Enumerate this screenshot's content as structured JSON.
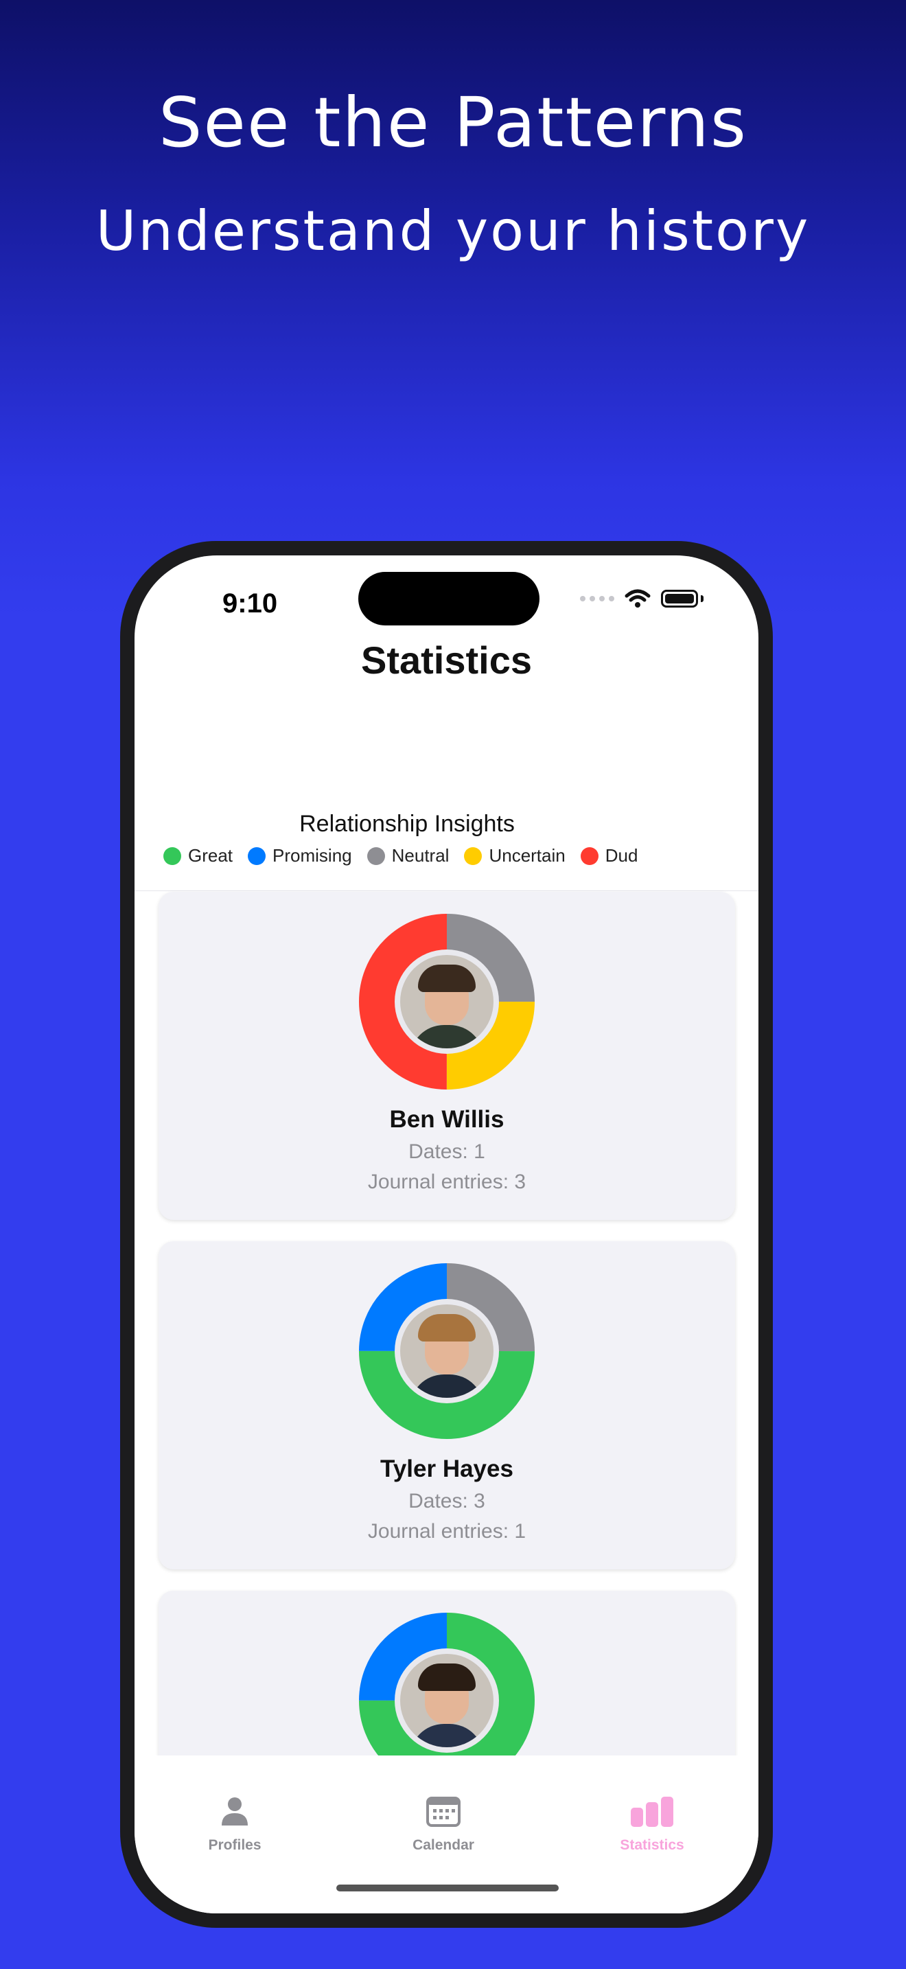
{
  "promo": {
    "headline": "See the Patterns",
    "subheadline": "Understand your history"
  },
  "status_bar": {
    "time": "9:10"
  },
  "nav": {
    "title": "Statistics"
  },
  "insights": {
    "title": "Relationship Insights",
    "legend": [
      {
        "label": "Great",
        "color": "#34c759"
      },
      {
        "label": "Promising",
        "color": "#007aff"
      },
      {
        "label": "Neutral",
        "color": "#8e8e93"
      },
      {
        "label": "Uncertain",
        "color": "#ffcc00"
      },
      {
        "label": "Dud",
        "color": "#ff3b30"
      }
    ]
  },
  "profiles": [
    {
      "name": "Ben Willis",
      "dates": "Dates: 1",
      "journal": "Journal entries: 3",
      "breakdown": {
        "Neutral": 0.25,
        "Uncertain": 0.25,
        "Dud": 0.5
      }
    },
    {
      "name": "Tyler Hayes",
      "dates": "Dates: 3",
      "journal": "Journal entries: 1",
      "breakdown": {
        "Great": 0.5,
        "Promising": 0.25,
        "Neutral": 0.25
      }
    },
    {
      "name": "",
      "dates": "",
      "journal": "",
      "breakdown": {
        "Great": 0.75,
        "Promising": 0.25
      }
    }
  ],
  "tabs": [
    {
      "label": "Profiles",
      "icon": "person-icon",
      "active": false
    },
    {
      "label": "Calendar",
      "icon": "calendar-icon",
      "active": false
    },
    {
      "label": "Statistics",
      "icon": "bar-chart-icon",
      "active": true
    }
  ]
}
